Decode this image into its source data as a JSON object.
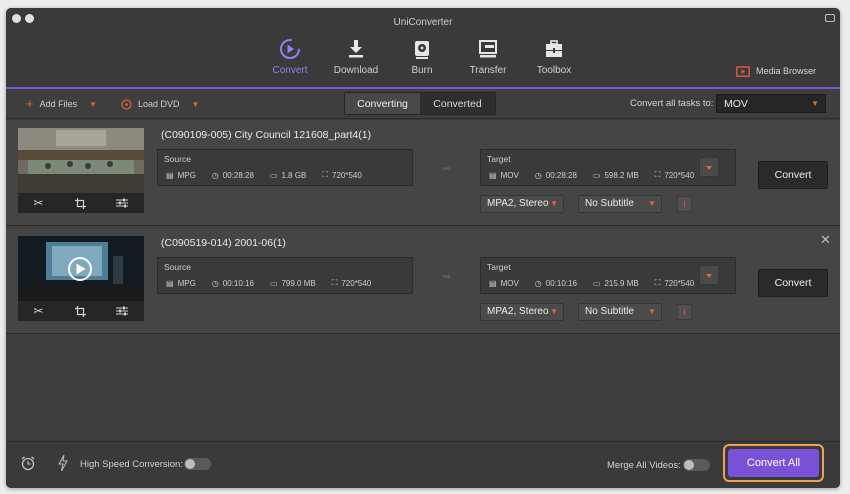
{
  "app_title": "UniConverter",
  "nav": [
    {
      "label": "Convert",
      "icon": "convert-icon",
      "active": true
    },
    {
      "label": "Download",
      "icon": "download-icon",
      "active": false
    },
    {
      "label": "Burn",
      "icon": "burn-icon",
      "active": false
    },
    {
      "label": "Transfer",
      "icon": "transfer-icon",
      "active": false
    },
    {
      "label": "Toolbox",
      "icon": "toolbox-icon",
      "active": false
    }
  ],
  "media_browser_label": "Media Browser",
  "toolbar": {
    "add_files_label": "Add Files",
    "load_dvd_label": "Load DVD",
    "tabs": {
      "converting": "Converting",
      "converted": "Converted"
    },
    "convert_all_tasks_label": "Convert all tasks to:",
    "format_value": "MOV"
  },
  "files": [
    {
      "title": "(C090109-005) City Council 121608_part4(1)",
      "source": {
        "caption": "Source",
        "format": "MPG",
        "duration": "00:28:28",
        "size": "1.8 GB",
        "resolution": "720*540"
      },
      "target": {
        "caption": "Target",
        "format": "MOV",
        "duration": "00:28:28",
        "size": "598.2 MB",
        "resolution": "720*540"
      },
      "audio": "MPA2, Stereo",
      "subtitle": "No Subtitle",
      "info_label": "i",
      "convert_label": "Convert"
    },
    {
      "title": "(C090519-014) 2001-06(1)",
      "source": {
        "caption": "Source",
        "format": "MPG",
        "duration": "00:10:16",
        "size": "799.0 MB",
        "resolution": "720*540"
      },
      "target": {
        "caption": "Target",
        "format": "MOV",
        "duration": "00:10:16",
        "size": "215.9 MB",
        "resolution": "720*540"
      },
      "audio": "MPA2, Stereo",
      "subtitle": "No Subtitle",
      "info_label": "i",
      "convert_label": "Convert"
    }
  ],
  "footer": {
    "high_speed_label": "High Speed Conversion:",
    "merge_label": "Merge All Videos:",
    "convert_all_label": "Convert All"
  },
  "colors": {
    "accent": "#7a52d8",
    "highlight": "#f0a050",
    "warning": "#e9603f"
  }
}
